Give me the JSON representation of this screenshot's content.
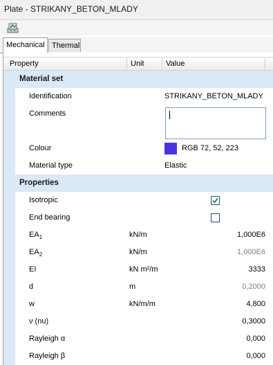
{
  "window": {
    "title": "Plate - STRIKANY_BETON_MLADY"
  },
  "toolbar": {
    "icon": "material-database-icon"
  },
  "tabs": [
    {
      "label": "Mechanical",
      "active": true
    },
    {
      "label": "Thermal",
      "active": false
    }
  ],
  "columns": {
    "property": "Property",
    "unit": "Unit",
    "value": "Value"
  },
  "material_set": {
    "heading": "Material set",
    "identification_label": "Identification",
    "identification_value": "STRIKANY_BETON_MLADY",
    "comments_label": "Comments",
    "comments_value": "",
    "colour_label": "Colour",
    "colour_value": "RGB 72, 52, 223",
    "colour_hex": "#4834df",
    "material_type_label": "Material type",
    "material_type_value": "Elastic"
  },
  "properties": {
    "heading": "Properties",
    "isotropic_label": "Isotropic",
    "isotropic_checked": true,
    "end_bearing_label": "End bearing",
    "end_bearing_checked": false,
    "ea1": {
      "label": "EA",
      "sub": "1",
      "unit": "kN/m",
      "value": "1,000E6"
    },
    "ea2": {
      "label": "EA",
      "sub": "2",
      "unit": "kN/m",
      "value": "1,000E6"
    },
    "ei": {
      "label": "EI",
      "unit": "kN m²/m",
      "value": "3333"
    },
    "d": {
      "label": "d",
      "unit": "m",
      "value": "0,2000"
    },
    "w": {
      "label": "w",
      "unit": "kN/m/m",
      "value": "4,800"
    },
    "nu": {
      "label": "ν (nu)",
      "unit": "",
      "value": "0,3000"
    },
    "rayleigh_alpha": {
      "label": "Rayleigh α",
      "unit": "",
      "value": "0,000"
    },
    "rayleigh_beta": {
      "label": "Rayleigh β",
      "unit": "",
      "value": "0,000"
    }
  }
}
